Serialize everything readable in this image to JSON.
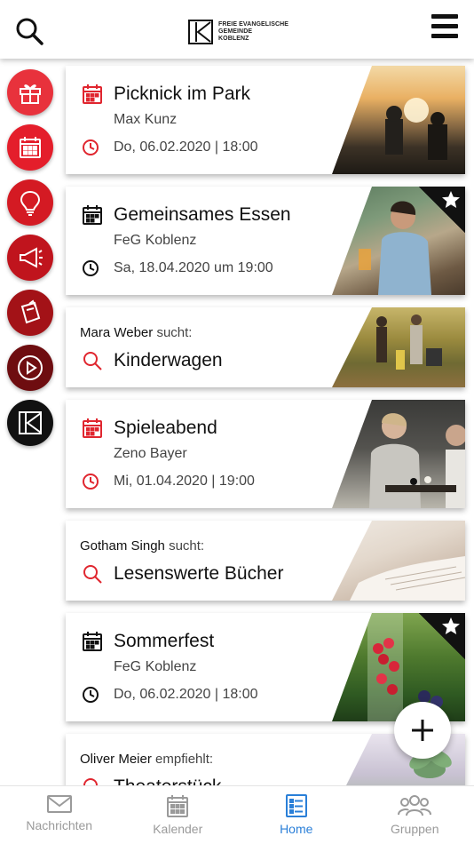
{
  "header": {
    "search_icon": "search-icon",
    "menu_icon": "hamburger-menu-icon",
    "logo_lines": [
      "FREIE EVANGELISCHE",
      "GEMEINDE",
      "KOBLENZ"
    ]
  },
  "rail": {
    "items": [
      {
        "name": "gift",
        "icon": "gift-icon",
        "color": "#e8323c"
      },
      {
        "name": "calendar",
        "icon": "calendar-icon",
        "color": "#e41e2b"
      },
      {
        "name": "idea",
        "icon": "lightbulb-icon",
        "color": "#d41a23"
      },
      {
        "name": "announcement",
        "icon": "megaphone-icon",
        "color": "#c0141d"
      },
      {
        "name": "notes",
        "icon": "notes-icon",
        "color": "#a31217"
      },
      {
        "name": "media",
        "icon": "play-icon",
        "color": "#6e0d10"
      },
      {
        "name": "church",
        "icon": "feg-logo-icon",
        "color": "#111111"
      }
    ]
  },
  "feed": {
    "cards": [
      {
        "type": "event",
        "title": "Picknick im Park",
        "organizer": "Max Kunz",
        "when": "Do, 06.02.2020 | 18:00",
        "accent": "#e0262f",
        "featured": false
      },
      {
        "type": "event",
        "title": "Gemeinsames Essen",
        "organizer": "FeG Koblenz",
        "when": "Sa, 18.04.2020 um 19:00",
        "accent": "#111111",
        "featured": true
      },
      {
        "type": "search",
        "person": "Mara Weber",
        "verb": "sucht:",
        "title": "Kinderwagen"
      },
      {
        "type": "event",
        "title": "Spieleabend",
        "organizer": "Zeno Bayer",
        "when": "Mi, 01.04.2020 | 19:00",
        "accent": "#e0262f",
        "featured": false
      },
      {
        "type": "search",
        "person": "Gotham Singh",
        "verb": "sucht:",
        "title": "Lesenswerte Bücher"
      },
      {
        "type": "event",
        "title": "Sommerfest",
        "organizer": "FeG Koblenz",
        "when": "Do, 06.02.2020 | 18:00",
        "accent": "#111111",
        "featured": true
      },
      {
        "type": "recommend",
        "person": "Oliver Meier",
        "verb": "empfiehlt:",
        "title": "Theaterstück"
      }
    ]
  },
  "fab": {
    "icon": "plus-icon"
  },
  "tabbar": {
    "tabs": [
      {
        "label": "Nachrichten",
        "icon": "envelope-icon",
        "active": false
      },
      {
        "label": "Kalender",
        "icon": "calendar-icon",
        "active": false
      },
      {
        "label": "Home",
        "icon": "list-icon",
        "active": true
      },
      {
        "label": "Gruppen",
        "icon": "group-icon",
        "active": false
      }
    ]
  },
  "colors": {
    "accent_red": "#e0262f",
    "active_blue": "#2a7fd8"
  }
}
